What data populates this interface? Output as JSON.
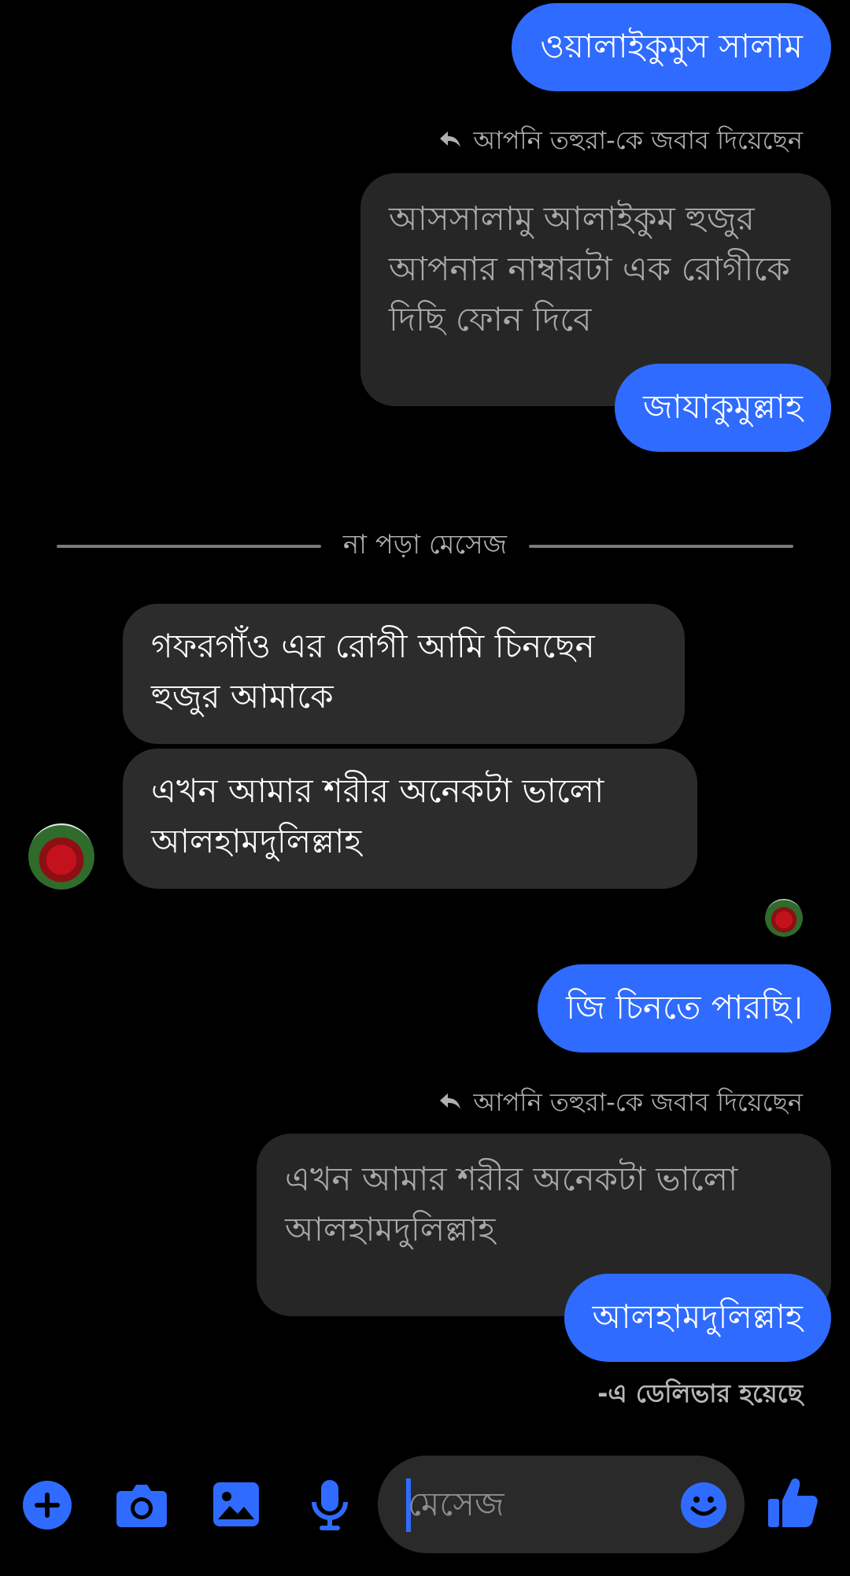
{
  "messages": {
    "m1": "ওয়ালাইকুমুস সালাম",
    "reply_note_1": "আপনি তহুরা-কে জবাব দিয়েছেন",
    "quoted_1": "আসসালামু আলাইকুম হুজুর আপনার নাম্বারটা এক রোগীকে দিছি ফোন দিবে",
    "m2": "জাযাকুমুল্লাহ",
    "unread_divider": "না পড়া মেসেজ",
    "in1": "গফরগাঁও এর রোগী আমি চিনছেন হুজুর আমাকে",
    "in2": "এখন আমার শরীর অনেকটা ভালো আলহামদুলিল্লাহ",
    "m3": "জি চিনতে পারছি।",
    "reply_note_2": "আপনি তহুরা-কে জবাব দিয়েছেন",
    "quoted_2": "এখন আমার শরীর অনেকটা ভালো আলহামদুলিল্লাহ",
    "m4": "আলহামদুলিল্লাহ",
    "status": "-এ ডেলিভার হয়েছে"
  },
  "composer": {
    "placeholder": "মেসেজ"
  },
  "colors": {
    "accent": "#2f6bff",
    "incoming_bubble": "#2c2c2c",
    "quoted_bubble": "#262626",
    "background": "#000000"
  },
  "icons": [
    "plus-circle-icon",
    "camera-icon",
    "gallery-icon",
    "microphone-icon",
    "emoji-icon",
    "like-icon",
    "reply-arrow-icon"
  ]
}
